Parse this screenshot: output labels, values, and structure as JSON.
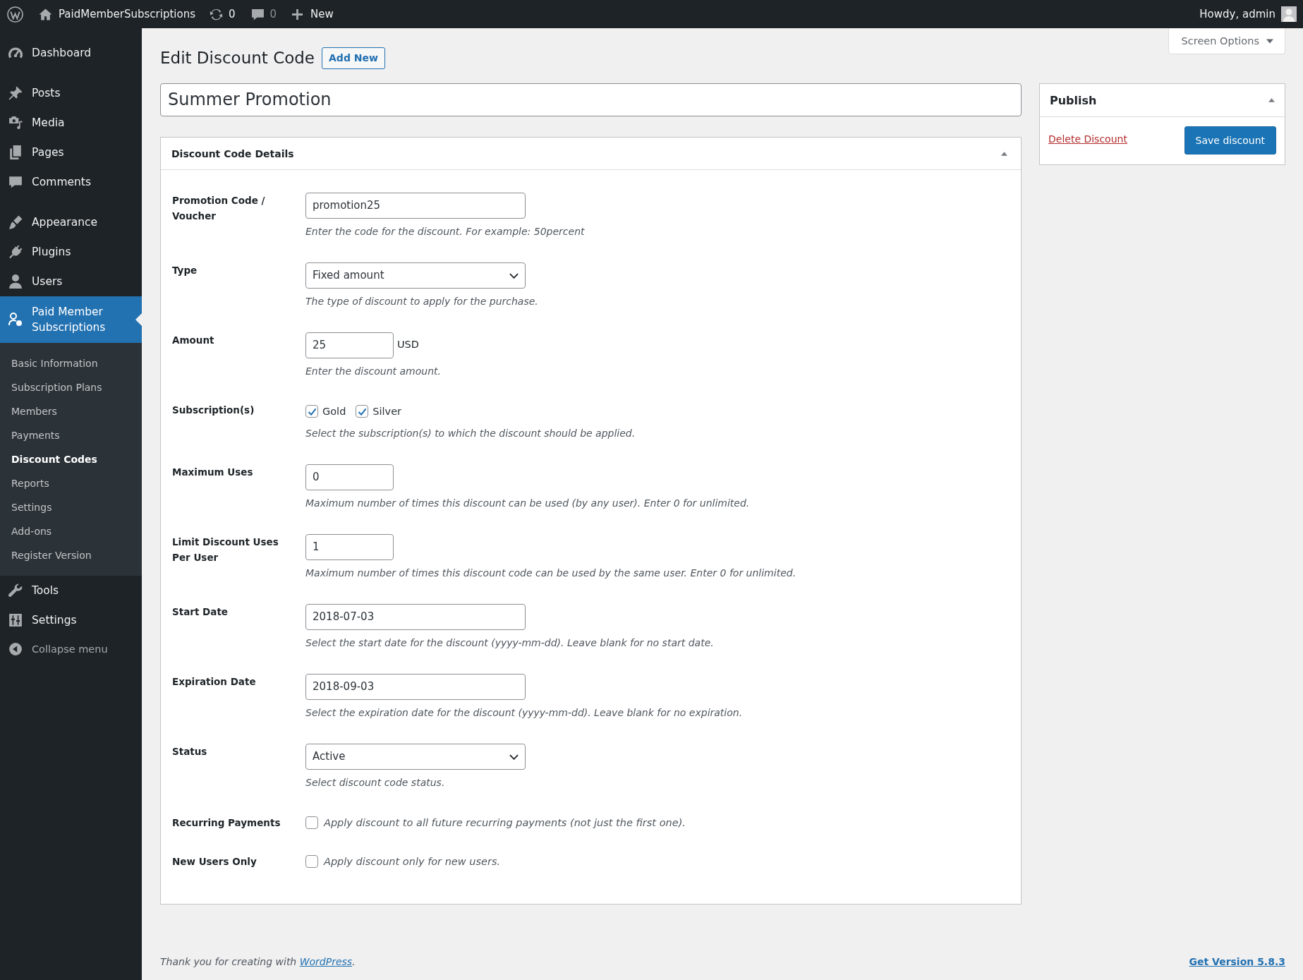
{
  "admin_bar": {
    "site_name": "PaidMemberSubscriptions",
    "updates_count": "0",
    "comments_count": "0",
    "new_label": "New",
    "greeting": "Howdy, admin"
  },
  "sidebar": {
    "groups": [
      {
        "items": [
          {
            "label": "Dashboard",
            "selected": false
          }
        ]
      },
      {
        "items": [
          {
            "label": "Posts",
            "selected": false
          },
          {
            "label": "Media",
            "selected": false
          },
          {
            "label": "Pages",
            "selected": false
          },
          {
            "label": "Comments",
            "selected": false
          }
        ]
      },
      {
        "items": [
          {
            "label": "Appearance",
            "selected": false
          },
          {
            "label": "Plugins",
            "selected": false
          },
          {
            "label": "Users",
            "selected": false
          },
          {
            "label": "Paid Member Subscriptions",
            "selected": true,
            "children": [
              {
                "label": "Basic Information",
                "selected": false
              },
              {
                "label": "Subscription Plans",
                "selected": false
              },
              {
                "label": "Members",
                "selected": false
              },
              {
                "label": "Payments",
                "selected": false
              },
              {
                "label": "Discount Codes",
                "selected": true
              },
              {
                "label": "Reports",
                "selected": false
              },
              {
                "label": "Settings",
                "selected": false
              },
              {
                "label": "Add-ons",
                "selected": false
              },
              {
                "label": "Register Version",
                "selected": false
              }
            ]
          },
          {
            "label": "Tools",
            "selected": false
          },
          {
            "label": "Settings",
            "selected": false
          }
        ]
      }
    ],
    "collapse_label": "Collapse menu"
  },
  "screen_options": {
    "label": "Screen Options"
  },
  "header": {
    "title": "Edit Discount Code",
    "add_new": "Add New"
  },
  "title_field": {
    "value": "Summer Promotion"
  },
  "details": {
    "title": "Discount Code Details",
    "expanded": true,
    "fields": [
      {
        "kind": "text",
        "label": "Promotion Code / Voucher",
        "value": "promotion25",
        "description": "Enter the code for the discount. For example: 50percent"
      },
      {
        "kind": "select",
        "label": "Type",
        "value": "Fixed amount",
        "description": "The type of discount to apply for the purchase."
      },
      {
        "kind": "amount",
        "label": "Amount",
        "value": "25",
        "unit": "USD",
        "description": "Enter the discount amount."
      },
      {
        "kind": "checkboxes",
        "label": "Subscription(s)",
        "options": [
          {
            "label": "Gold",
            "checked": true
          },
          {
            "label": "Silver",
            "checked": true
          }
        ],
        "description": "Select the subscription(s) to which the discount should be applied."
      },
      {
        "kind": "number",
        "label": "Maximum Uses",
        "value": "0",
        "description": "Maximum number of times this discount can be used (by any user). Enter 0 for unlimited."
      },
      {
        "kind": "number",
        "label": "Limit Discount Uses Per User",
        "value": "1",
        "description": "Maximum number of times this discount code can be used by the same user. Enter 0 for unlimited."
      },
      {
        "kind": "text",
        "label": "Start Date",
        "value": "2018-07-03",
        "description": "Select the start date for the discount (yyyy-mm-dd). Leave blank for no start date."
      },
      {
        "kind": "text",
        "label": "Expiration Date",
        "value": "2018-09-03",
        "description": "Select the expiration date for the discount (yyyy-mm-dd). Leave blank for no expiration."
      },
      {
        "kind": "select",
        "label": "Status",
        "value": "Active",
        "description": "Select discount code status."
      },
      {
        "kind": "checkbox",
        "label": "Recurring Payments",
        "checked": false,
        "description": "Apply discount to all future recurring payments (not just the first one)."
      },
      {
        "kind": "checkbox",
        "label": "New Users Only",
        "checked": false,
        "description": "Apply discount only for new users."
      }
    ]
  },
  "publish": {
    "title": "Publish",
    "expanded": true,
    "delete_label": "Delete Discount",
    "save_label": "Save discount"
  },
  "footer": {
    "thanks": "Thank you for creating with",
    "link": "WordPress",
    "after": ".",
    "version": "Get Version 5.8.3"
  }
}
